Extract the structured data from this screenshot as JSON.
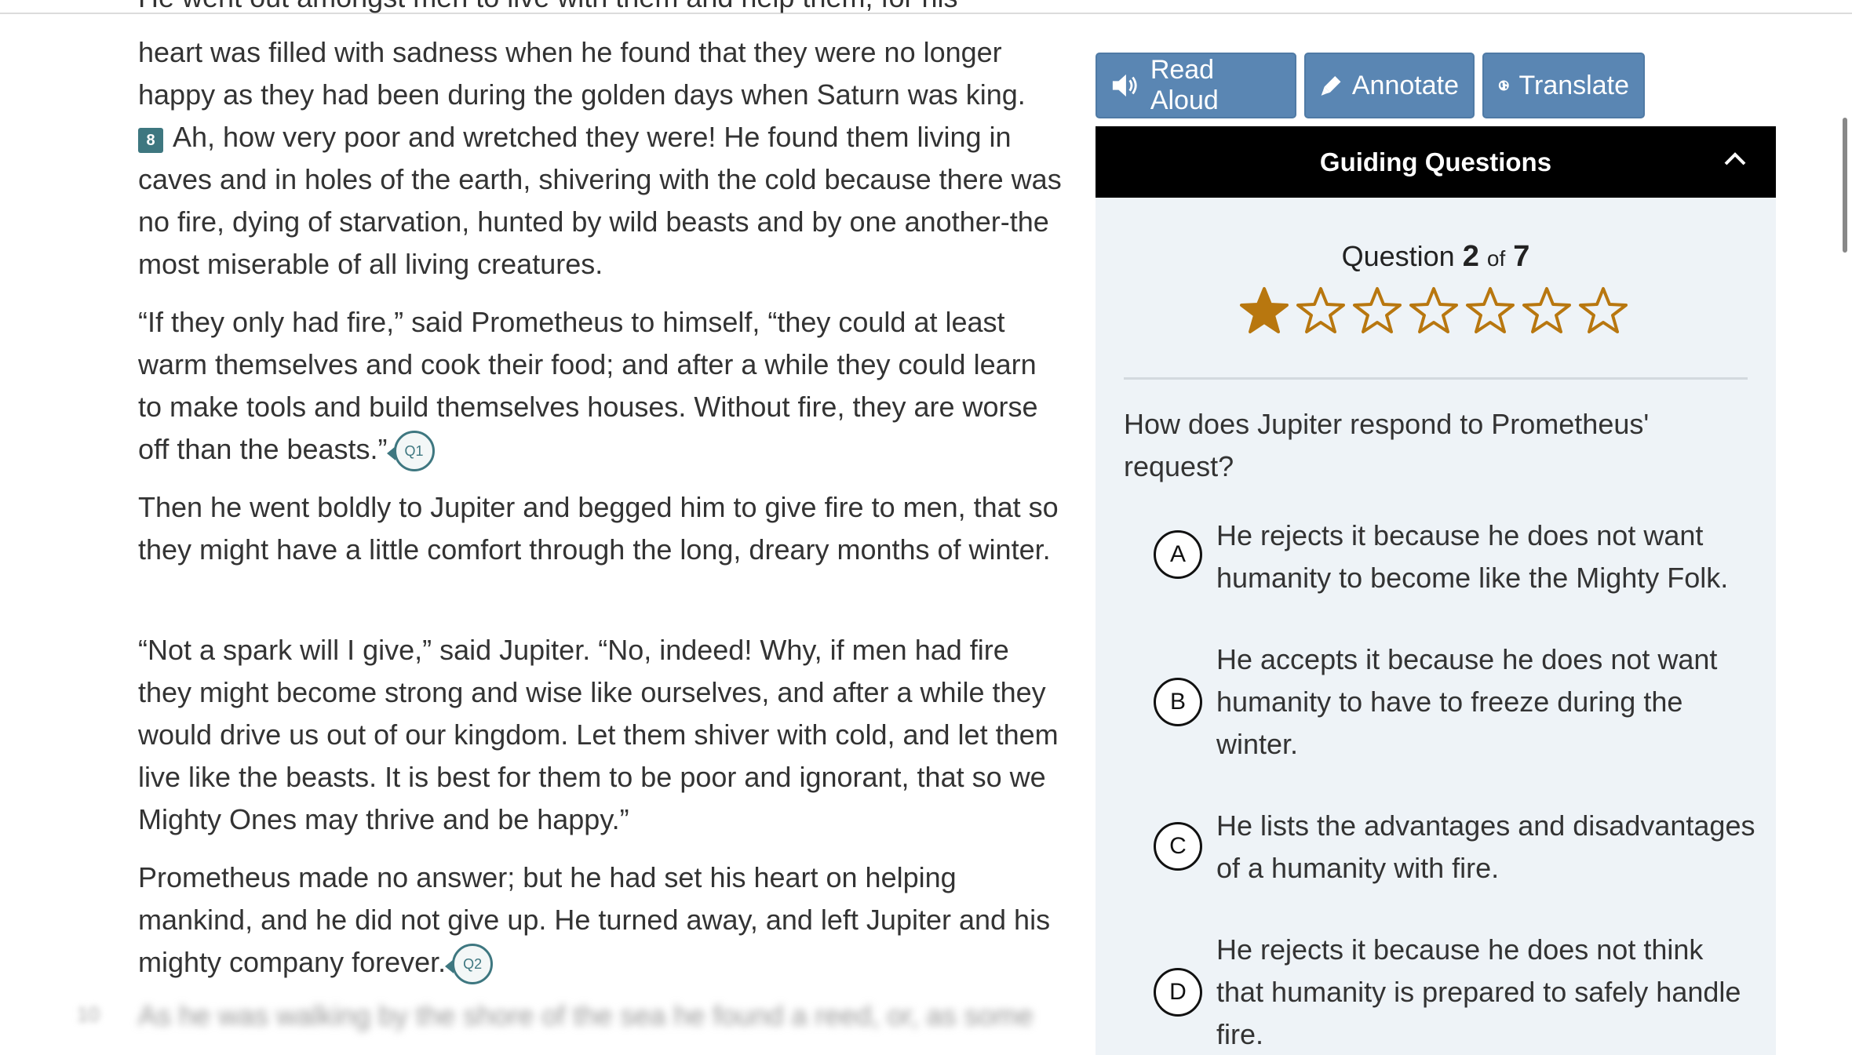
{
  "passage": {
    "clipped_top_line": "He went out amongst men to live with them and help them, for his",
    "p1_line1": "heart was filled with sadness when he found that they were no longer",
    "p1_line2": "happy as they had been during the golden days when Saturn was king.",
    "para8_number": "8",
    "para8_text": "Ah, how very poor and wretched they were! He found them living in caves and in holes of the earth, shivering with the cold because there was no fire, dying of starvation, hunted by wild beasts and by one another-the most miserable of all living creatures.",
    "p2_text": "“If they only had fire,” said Prometheus to himself, “they could at least warm themselves and cook their food; and after a while they could learn to make tools and build themselves houses. Without fire, they are worse off than the beasts.”",
    "q1_marker": "Q1",
    "p3_text": "Then he went boldly to Jupiter and begged him to give fire to men, that so they might have a little comfort through the long, dreary months of winter.",
    "p4_text": "“Not a spark will I give,” said Jupiter. “No, indeed! Why, if men had fire they might become strong and wise like ourselves, and after a while they would drive us out of our kingdom. Let them shiver with cold, and let them live like the beasts. It is best for them to be poor and ignorant, that so we Mighty Ones may thrive and be happy.”",
    "p5_text": "Prometheus made no answer; but he had set his heart on helping mankind, and he did not give up. He turned away, and left Jupiter and his mighty company forever.",
    "q2_marker": "Q2",
    "blurred_num": "10",
    "blurred_text": "As he was walking by the shore of the sea he found a reed, or, as some"
  },
  "toolbar": {
    "read_aloud": "Read Aloud",
    "annotate": "Annotate",
    "translate": "Translate",
    "icons": [
      "speaker-icon",
      "highlighter-icon",
      "globe-icon"
    ],
    "color": "#5a86b3"
  },
  "guiding": {
    "title": "Guiding Questions",
    "question_word": "Question",
    "current": "2",
    "of_word": "of",
    "total": "7",
    "stars_filled": 1,
    "stars_total": 7,
    "star_color": "#b8770f",
    "question": "How does Jupiter respond to Prometheus' request?",
    "options": [
      {
        "letter": "A",
        "text": "He rejects it because he does not want humanity to become like the Mighty Folk."
      },
      {
        "letter": "B",
        "text": "He accepts it because he does not want humanity to have to freeze during the winter."
      },
      {
        "letter": "C",
        "text": "He lists the advantages and disadvantages of a humanity with fire."
      },
      {
        "letter": "D",
        "text": "He rejects it because he does not think that humanity is prepared to safely handle fire."
      }
    ]
  }
}
